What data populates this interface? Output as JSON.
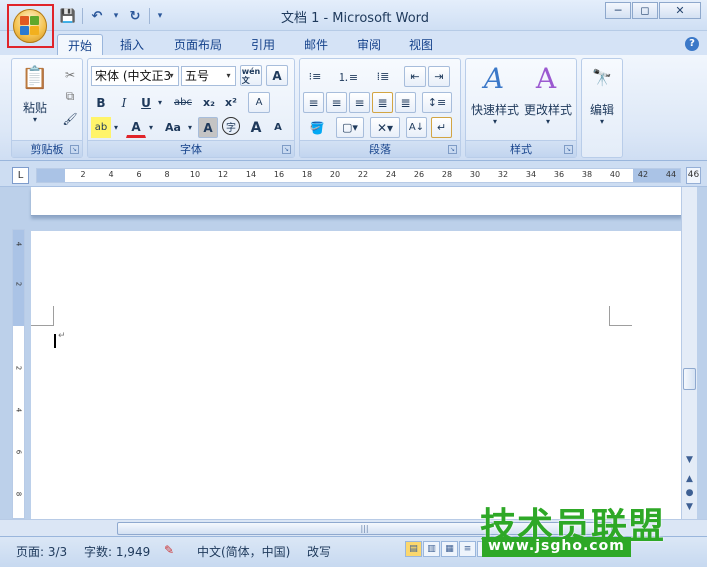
{
  "window": {
    "title": "文档 1 - Microsoft Word",
    "minimize": "─",
    "restore": "◻",
    "close": "✕"
  },
  "qat": {
    "save_icon": "💾",
    "undo_icon": "↶",
    "undo_dd": "▾",
    "redo_icon": "↻",
    "customize": "▾"
  },
  "tabs": [
    {
      "label": "开始",
      "active": true
    },
    {
      "label": "插入"
    },
    {
      "label": "页面布局"
    },
    {
      "label": "引用"
    },
    {
      "label": "邮件"
    },
    {
      "label": "审阅"
    },
    {
      "label": "视图"
    }
  ],
  "help": "?",
  "ribbon": {
    "clipboard": {
      "label": "剪贴板",
      "paste": "粘贴",
      "paste_dd": "▾",
      "cut": "✂",
      "copy": "⧉",
      "painter": "🖌"
    },
    "font": {
      "label": "字体",
      "font_name": "宋体 (中文正3",
      "font_size": "五号",
      "grow": "A",
      "wen": "wén\n文",
      "clear": "A",
      "bold": "B",
      "italic": "I",
      "underline": "U",
      "underline_dd": "▾",
      "strike": "abc",
      "subscript": "x₂",
      "superscript": "x²",
      "change_case": "Aa",
      "highlight": "ab",
      "font_color": "A",
      "char_shading": "A",
      "enclose": "字",
      "grow_font": "A",
      "shrink_font": "A",
      "format_clear": "A"
    },
    "paragraph": {
      "label": "段落"
    },
    "styles": {
      "label": "样式",
      "quick_styles": "快速样式",
      "change_styles": "更改样式"
    },
    "editing": {
      "label": "编辑"
    }
  },
  "ruler": {
    "corner": "L",
    "ticks": [
      "2",
      "4",
      "6",
      "8",
      "10",
      "12",
      "14",
      "16",
      "18",
      "20",
      "22",
      "24",
      "26",
      "28",
      "30",
      "32",
      "34",
      "36",
      "38",
      "40",
      "42",
      "44",
      "46"
    ],
    "v_ticks": [
      "4",
      "2",
      "2",
      "4",
      "6",
      "8"
    ]
  },
  "document": {
    "para_mark": "↵"
  },
  "status": {
    "page": "页面: 3/3",
    "words": "字数: 1,949",
    "language": "中文(简体，中国)",
    "mode": "改写"
  },
  "watermark": {
    "main": "技术员联盟",
    "url": "www.jsgho.com"
  },
  "colors": {
    "accent": "#15428b",
    "ribbon_bg": "#dde8f7",
    "workspace": "#bcd0ea",
    "highlight_red": "#e0242a",
    "watermark_green": "#2ea827"
  }
}
